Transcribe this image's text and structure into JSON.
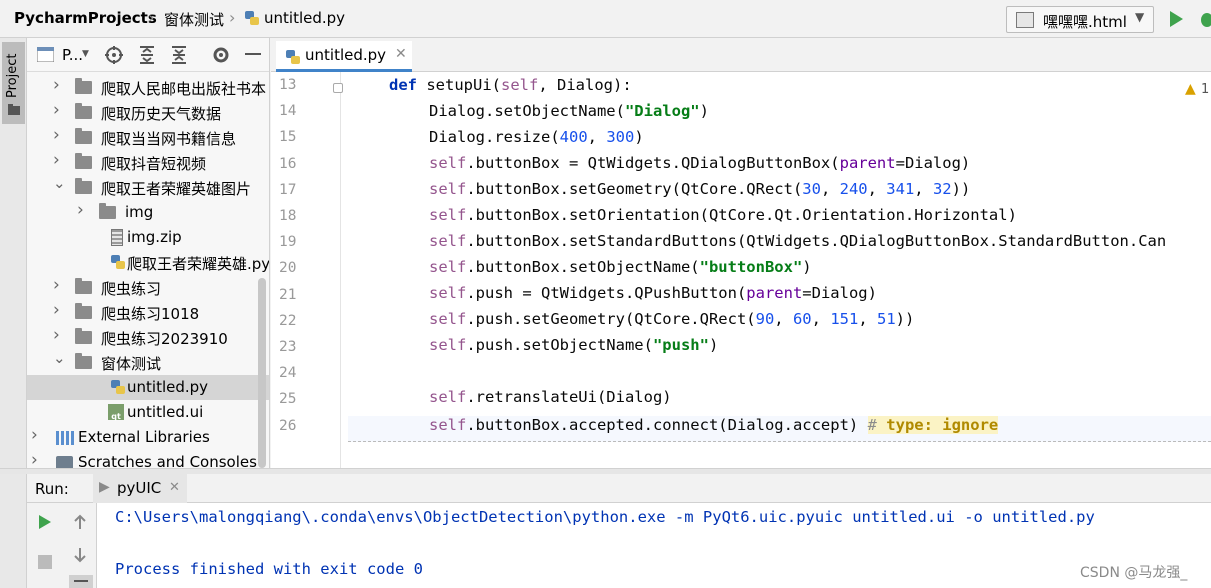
{
  "breadcrumb": {
    "project": "PycharmProjects",
    "folder": "窗体测试",
    "file": "untitled.py"
  },
  "run_config": {
    "label": "嘿嘿嘿.html"
  },
  "left_strip": {
    "project_tab": "Project"
  },
  "project_panel": {
    "view_label": "P...",
    "tree": [
      {
        "label": "爬取人民邮电出版社书本",
        "type": "folder",
        "expanded": false,
        "depth": 1
      },
      {
        "label": "爬取历史天气数据",
        "type": "folder",
        "expanded": false,
        "depth": 1
      },
      {
        "label": "爬取当当网书籍信息",
        "type": "folder",
        "expanded": false,
        "depth": 1
      },
      {
        "label": "爬取抖音短视频",
        "type": "folder",
        "expanded": false,
        "depth": 1
      },
      {
        "label": "爬取王者荣耀英雄图片",
        "type": "folder",
        "expanded": true,
        "depth": 1
      },
      {
        "label": "img",
        "type": "folder",
        "expanded": false,
        "depth": 2
      },
      {
        "label": "img.zip",
        "type": "zip",
        "depth": 2
      },
      {
        "label": "爬取王者荣耀英雄.py",
        "type": "py",
        "depth": 2
      },
      {
        "label": "爬虫练习",
        "type": "folder",
        "expanded": false,
        "depth": 1
      },
      {
        "label": "爬虫练习1018",
        "type": "folder",
        "expanded": false,
        "depth": 1
      },
      {
        "label": "爬虫练习2023910",
        "type": "folder",
        "expanded": false,
        "depth": 1
      },
      {
        "label": "窗体测试",
        "type": "folder",
        "expanded": true,
        "depth": 1
      },
      {
        "label": "untitled.py",
        "type": "py",
        "depth": 2,
        "selected": true
      },
      {
        "label": "untitled.ui",
        "type": "ui",
        "depth": 2
      },
      {
        "label": "External Libraries",
        "type": "lib",
        "depth": 0
      },
      {
        "label": "Scratches and Consoles",
        "type": "console",
        "depth": 0
      }
    ]
  },
  "editor": {
    "tab_label": "untitled.py",
    "warning_count": "1",
    "line_numbers": [
      "13",
      "14",
      "15",
      "16",
      "17",
      "18",
      "19",
      "20",
      "21",
      "22",
      "23",
      "24",
      "25",
      "26"
    ]
  },
  "run_panel": {
    "label": "Run:",
    "tab": "pyUIC",
    "output": [
      "C:\\Users\\malongqiang\\.conda\\envs\\ObjectDetection\\python.exe -m PyQt6.uic.pyuic untitled.ui -o untitled.py",
      "",
      "Process finished with exit code 0"
    ]
  },
  "watermark": "CSDN @马龙强_",
  "colors": {
    "keyword": "#0033b3",
    "self": "#94558d",
    "string": "#067d17",
    "number": "#1750eb",
    "param": "#660099",
    "accent": "#4083c9"
  }
}
